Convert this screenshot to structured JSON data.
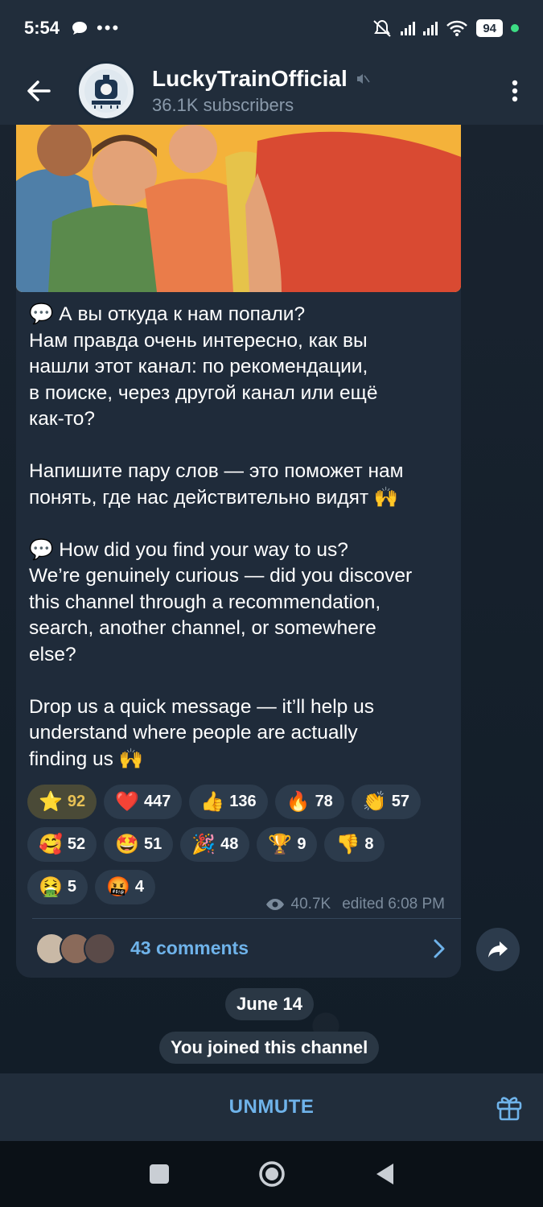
{
  "status_bar": {
    "time": "5:54",
    "battery": "94"
  },
  "header": {
    "channel_name": "LuckyTrainOfficial",
    "subscribers": "36.1K subscribers"
  },
  "message": {
    "text": "💬 А вы откуда к нам попали?\nНам правда очень интересно, как вы\nнашли этот канал: по рекомендации,\nв поиске, через другой канал или ещё\nкак-то?\n\nНапишите пару слов — это поможет нам\nпонять, где нас действительно видят 🙌\n\n💬 How did you find your way to us?\nWe’re genuinely curious — did you discover\nthis channel through a recommendation,\nsearch, another channel, or somewhere\nelse?\n\nDrop us a quick message — it’ll help us\nunderstand where people are actually\nfinding us 🙌",
    "views": "40.7K",
    "edited": "edited 6:08 PM",
    "comments_label": "43 comments"
  },
  "reactions": {
    "row1": [
      {
        "emoji": "⭐",
        "count": "92"
      },
      {
        "emoji": "❤️",
        "count": "447"
      },
      {
        "emoji": "👍",
        "count": "136"
      },
      {
        "emoji": "🔥",
        "count": "78"
      },
      {
        "emoji": "👏",
        "count": "57"
      }
    ],
    "row2": [
      {
        "emoji": "🥰",
        "count": "52"
      },
      {
        "emoji": "🤩",
        "count": "51"
      },
      {
        "emoji": "🎉",
        "count": "48"
      },
      {
        "emoji": "🏆",
        "count": "9"
      },
      {
        "emoji": "👎",
        "count": "8"
      }
    ],
    "row3": [
      {
        "emoji": "🤮",
        "count": "5"
      },
      {
        "emoji": "🤬",
        "count": "4"
      }
    ]
  },
  "service": {
    "date": "June 14",
    "joined": "You joined this channel"
  },
  "bottom": {
    "unmute_label": "UNMUTE"
  },
  "colors": {
    "accent": "#6fb3ea",
    "bubble": "#1f2b3a",
    "header": "#212d3b"
  }
}
